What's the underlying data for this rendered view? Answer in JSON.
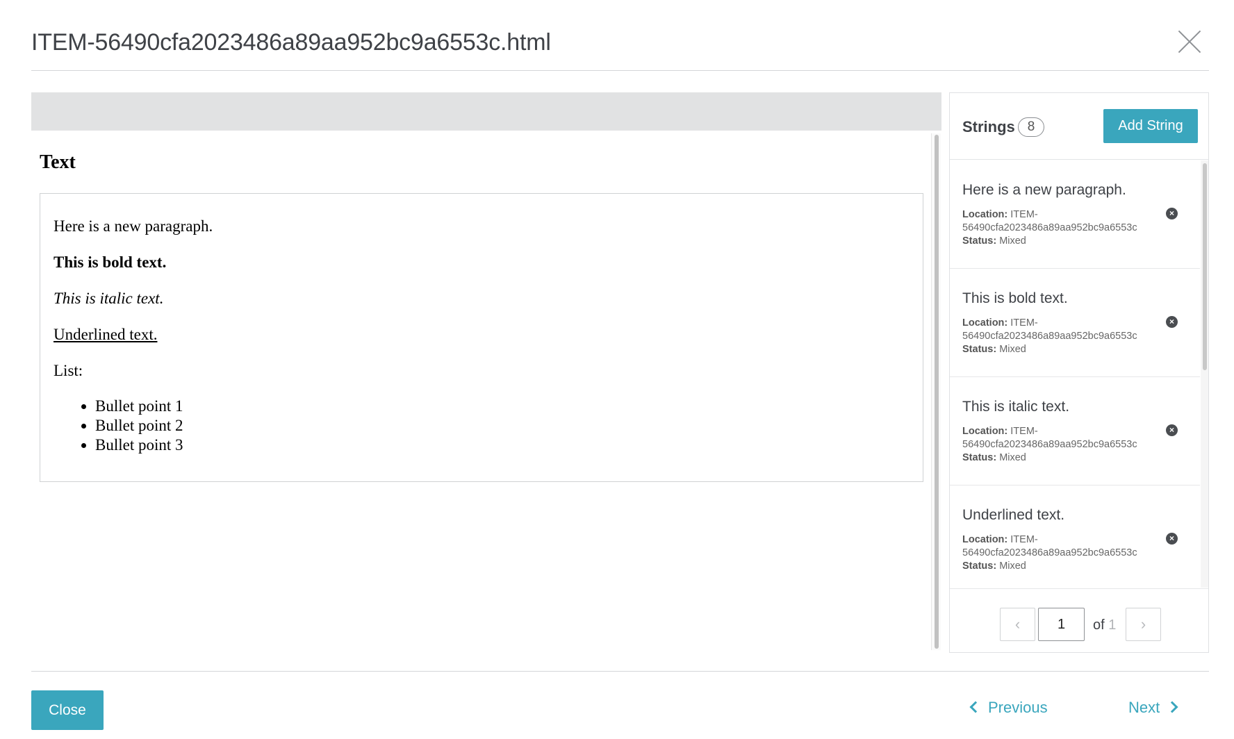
{
  "modal": {
    "title": "ITEM-56490cfa2023486a89aa952bc9a6553c.html",
    "close_icon": "close-icon"
  },
  "preview": {
    "heading": "Text",
    "paragraph": "Here is a new paragraph.",
    "bold": "This is bold text.",
    "italic": "This is italic text.",
    "underline": "Underlined text.",
    "list_label": "List:",
    "bullets": [
      "Bullet point 1",
      "Bullet point 2",
      "Bullet point 3"
    ]
  },
  "strings": {
    "title": "Strings",
    "count": "8",
    "add_label": "Add String",
    "location_label": "Location:",
    "status_label": "Status:",
    "items": [
      {
        "text": "Here is a new paragraph.",
        "location": "ITEM-56490cfa2023486a89aa952bc9a6553c",
        "status": "Mixed",
        "remove_icon": "remove-circle-icon"
      },
      {
        "text": "This is bold text.",
        "location": "ITEM-56490cfa2023486a89aa952bc9a6553c",
        "status": "Mixed",
        "remove_icon": "remove-circle-icon"
      },
      {
        "text": "This is italic text.",
        "location": "ITEM-56490cfa2023486a89aa952bc9a6553c",
        "status": "Mixed",
        "remove_icon": "remove-circle-icon"
      },
      {
        "text": "Underlined text.",
        "location": "ITEM-56490cfa2023486a89aa952bc9a6553c",
        "status": "Mixed",
        "remove_icon": "remove-circle-icon"
      }
    ],
    "pager": {
      "current": "1",
      "of_label": "of",
      "total": "1",
      "prev_icon": "chevron-left-icon",
      "next_icon": "chevron-right-icon"
    }
  },
  "footer": {
    "close_label": "Close",
    "previous_label": "Previous",
    "next_label": "Next"
  },
  "colors": {
    "accent": "#3aa6bd",
    "header_bar": "#e1e2e3",
    "title_text": "#3f4247"
  }
}
